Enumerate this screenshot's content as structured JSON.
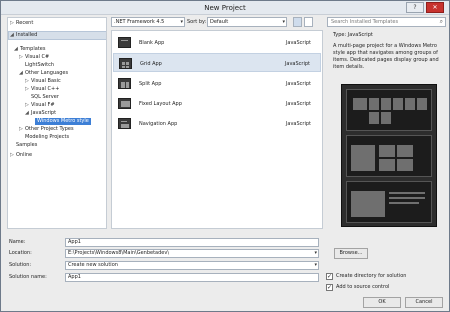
{
  "window": {
    "title": "New Project"
  },
  "tree": {
    "recent": "Recent",
    "installed": "Installed",
    "templates": "Templates",
    "visual_csharp": "Visual C#",
    "lightswitch": "LightSwitch",
    "other_languages": "Other Languages",
    "visual_basic": "Visual Basic",
    "visual_cpp": "Visual C++",
    "sql_server": "SQL Server",
    "visual_fsharp": "Visual F#",
    "javascript": "JavaScript",
    "windows_metro_style": "Windows Metro style",
    "other_project_types": "Other Project Types",
    "modeling_projects": "Modeling Projects",
    "samples": "Samples",
    "online": "Online"
  },
  "toolbar": {
    "framework": ".NET Framework 4.5",
    "sort_label": "Sort by:",
    "sort_value": "Default"
  },
  "templates": [
    {
      "name": "Blank App",
      "lang": "JavaScript"
    },
    {
      "name": "Grid App",
      "lang": "JavaScript"
    },
    {
      "name": "Split App",
      "lang": "JavaScript"
    },
    {
      "name": "Fixed Layout App",
      "lang": "JavaScript"
    },
    {
      "name": "Navigation App",
      "lang": "JavaScript"
    }
  ],
  "search": {
    "placeholder": "Search Installed Templates"
  },
  "details": {
    "type_label": "Type:",
    "type_value": "JavaScript",
    "description": "A multi-page project for a Windows Metro style app that navigates among groups of items. Dedicated pages display group and item details."
  },
  "form": {
    "name_label": "Name:",
    "name_value": "App1",
    "location_label": "Location:",
    "location_value": "E:\\Projects\\Windows8\\Main\\Genbetadev\\",
    "solution_label": "Solution:",
    "solution_value": "Create new solution",
    "solution_name_label": "Solution name:",
    "solution_name_value": "App1",
    "browse_label": "Browse...",
    "create_dir_label": "Create directory for solution",
    "create_dir_checked": true,
    "source_control_label": "Add to source control",
    "source_control_checked": true,
    "ok_label": "OK",
    "cancel_label": "Cancel"
  }
}
